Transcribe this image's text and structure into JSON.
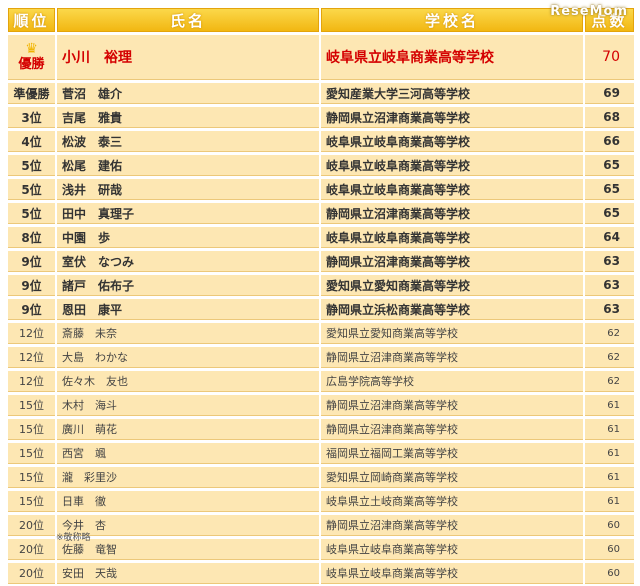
{
  "logo": "ReseMom",
  "headers": {
    "rank": "順位",
    "name": "氏名",
    "school": "学校名",
    "score": "点数"
  },
  "winner": {
    "label": "優勝",
    "name": "小川　裕理",
    "school": "岐阜県立岐阜商業高等学校",
    "score": "70"
  },
  "rows": [
    {
      "rank": "準優勝",
      "name": "菅沼　雄介",
      "school": "愛知産業大学三河高等学校",
      "score": "69",
      "style": "bold"
    },
    {
      "rank": "3位",
      "name": "吉尾　雅貴",
      "school": "静岡県立沼津商業高等学校",
      "score": "68",
      "style": "bold"
    },
    {
      "rank": "4位",
      "name": "松波　泰三",
      "school": "岐阜県立岐阜商業高等学校",
      "score": "66",
      "style": "bold"
    },
    {
      "rank": "5位",
      "name": "松尾　建佑",
      "school": "岐阜県立岐阜商業高等学校",
      "score": "65",
      "style": "bold"
    },
    {
      "rank": "5位",
      "name": "浅井　研哉",
      "school": "岐阜県立岐阜商業高等学校",
      "score": "65",
      "style": "bold"
    },
    {
      "rank": "5位",
      "name": "田中　真理子",
      "school": "静岡県立沼津商業高等学校",
      "score": "65",
      "style": "bold"
    },
    {
      "rank": "8位",
      "name": "中園　歩",
      "school": "岐阜県立岐阜商業高等学校",
      "score": "64",
      "style": "bold"
    },
    {
      "rank": "9位",
      "name": "室伏　なつみ",
      "school": "静岡県立沼津商業高等学校",
      "score": "63",
      "style": "bold"
    },
    {
      "rank": "9位",
      "name": "諸戸　佑布子",
      "school": "愛知県立愛知商業高等学校",
      "score": "63",
      "style": "bold"
    },
    {
      "rank": "9位",
      "name": "恩田　康平",
      "school": "静岡県立浜松商業高等学校",
      "score": "63",
      "style": "bold"
    },
    {
      "rank": "12位",
      "name": "斎藤　未奈",
      "school": "愛知県立愛知商業高等学校",
      "score": "62",
      "style": "small"
    },
    {
      "rank": "12位",
      "name": "大島　わかな",
      "school": "静岡県立沼津商業高等学校",
      "score": "62",
      "style": "small"
    },
    {
      "rank": "12位",
      "name": "佐々木　友也",
      "school": "広島学院高等学校",
      "score": "62",
      "style": "small"
    },
    {
      "rank": "15位",
      "name": "木村　海斗",
      "school": "静岡県立沼津商業高等学校",
      "score": "61",
      "style": "small"
    },
    {
      "rank": "15位",
      "name": "廣川　萌花",
      "school": "静岡県立沼津商業高等学校",
      "score": "61",
      "style": "small"
    },
    {
      "rank": "15位",
      "name": "西宮　颯",
      "school": "福岡県立福岡工業高等学校",
      "score": "61",
      "style": "small"
    },
    {
      "rank": "15位",
      "name": "瀧　彩里沙",
      "school": "愛知県立岡崎商業高等学校",
      "score": "61",
      "style": "small"
    },
    {
      "rank": "15位",
      "name": "日車　徹",
      "school": "岐阜県立土岐商業高等学校",
      "score": "61",
      "style": "small"
    },
    {
      "rank": "20位",
      "name": "今井　杏",
      "school": "静岡県立沼津商業高等学校",
      "score": "60",
      "style": "small"
    },
    {
      "rank": "20位",
      "name": "佐藤　竜智",
      "school": "岐阜県立岐阜商業高等学校",
      "score": "60",
      "style": "small"
    },
    {
      "rank": "20位",
      "name": "安田　天哉",
      "school": "岐阜県立岐阜商業高等学校",
      "score": "60",
      "style": "small"
    }
  ],
  "note": "※敬称略"
}
